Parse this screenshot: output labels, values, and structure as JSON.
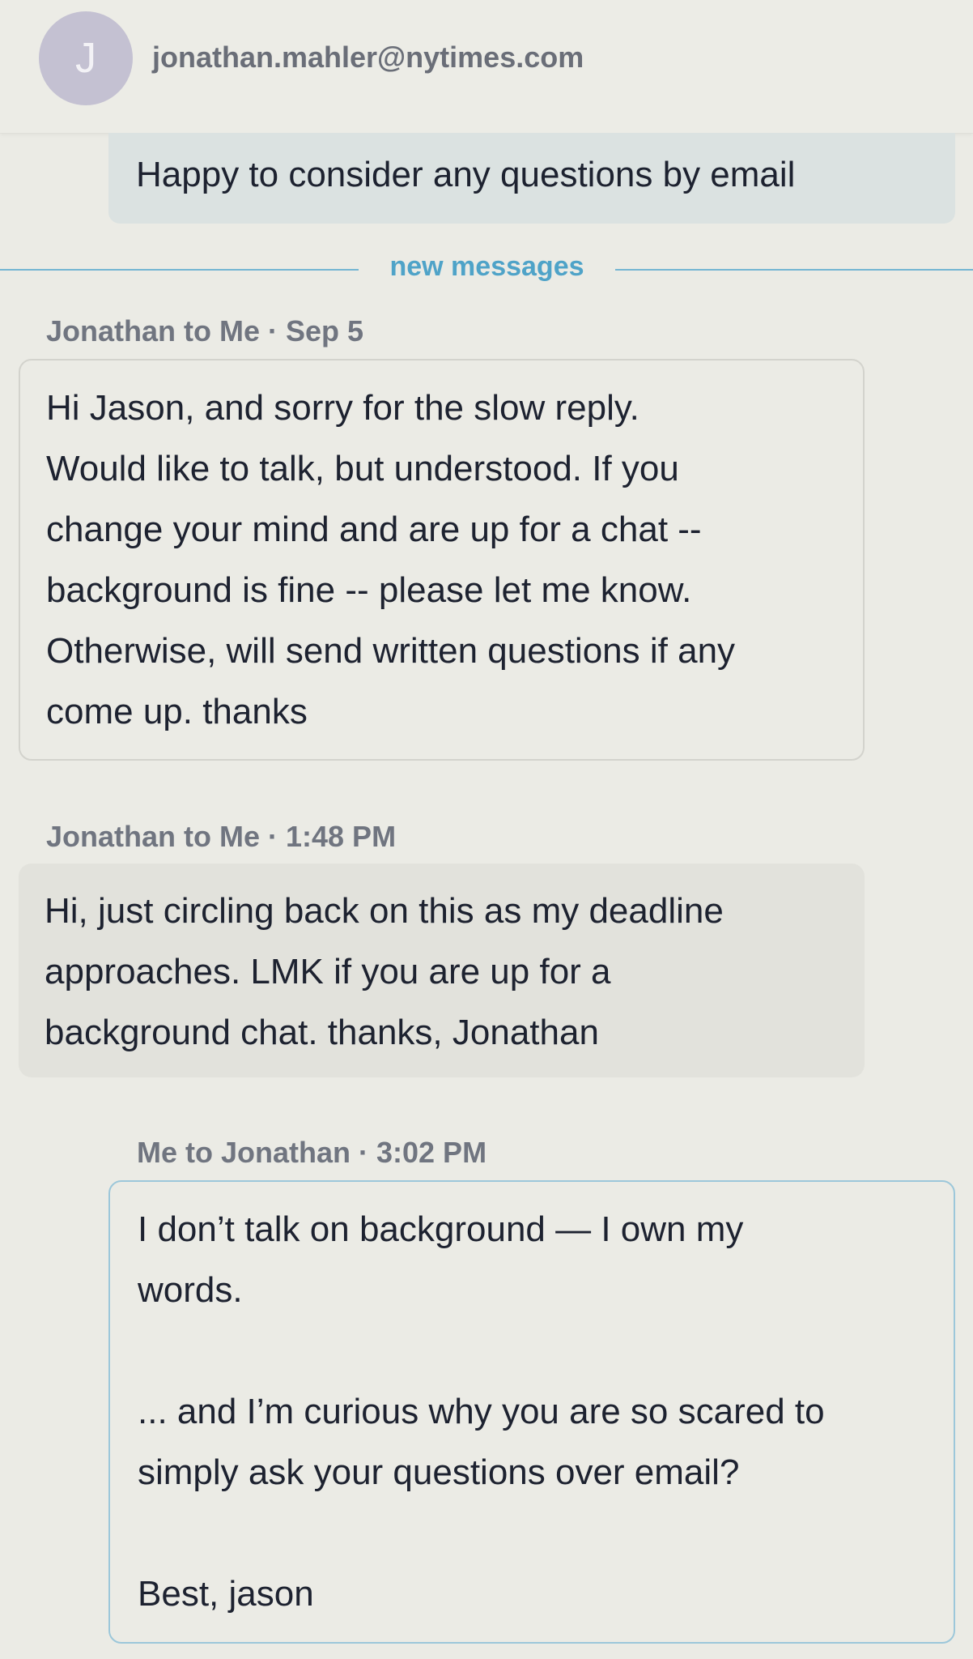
{
  "header": {
    "avatar_initial": "J",
    "email": "jonathan.mahler@nytimes.com"
  },
  "previous_message": {
    "text": "Happy to consider any questions by email"
  },
  "divider": {
    "label": "new messages"
  },
  "messages": [
    {
      "meta": "Jonathan to Me · Sep 5",
      "text": "Hi Jason, and sorry for the slow reply.\nWould like to talk, but understood. If you\nchange your mind and are up for a chat --\nbackground is fine -- please let me know.\nOtherwise, will send written questions if any\ncome up. thanks"
    },
    {
      "meta": "Jonathan to Me · 1:48 PM",
      "text": "Hi, just circling back on this as my deadline\napproaches. LMK if you are up for a\nbackground chat. thanks, Jonathan"
    },
    {
      "meta": "Me to Jonathan · 3:02 PM",
      "text": "I don’t talk on background — I own my\nwords.\n\n... and I’m curious why you are so scared to\nsimply ask your questions over email?\n\nBest, jason"
    }
  ],
  "colors": {
    "background": "#ebebe5",
    "accent": "#4fa3c8",
    "divider": "#74b5d2",
    "avatar": "#c4c1d2",
    "sent_border": "#9cc7da",
    "received_fill": "#e2e2dc"
  },
  "icons": {
    "avatar": "avatar-initial"
  }
}
